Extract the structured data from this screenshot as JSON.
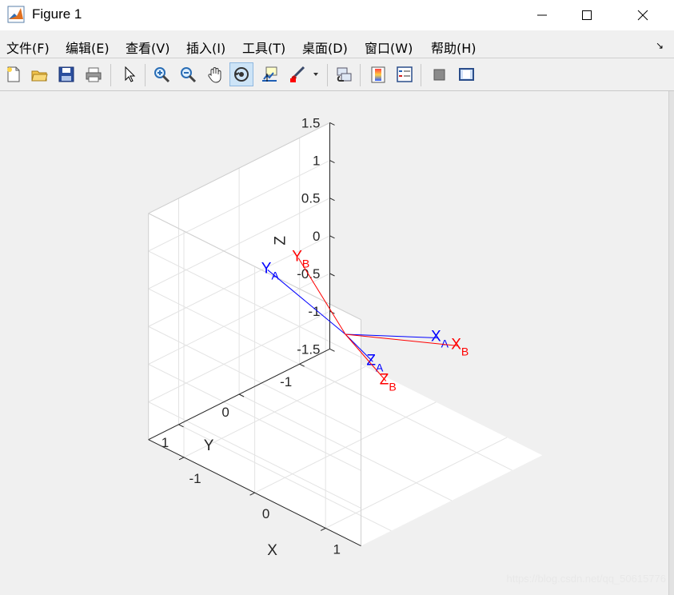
{
  "window": {
    "title": "Figure 1",
    "controls": {
      "minimize": "—",
      "maximize": "☐",
      "close": "✕"
    }
  },
  "menu": {
    "items": [
      "文件(F)",
      "编辑(E)",
      "查看(V)",
      "插入(I)",
      "工具(T)",
      "桌面(D)",
      "窗口(W)",
      "帮助(H)"
    ],
    "dock_arrow": "↘"
  },
  "toolbar": {
    "buttons": [
      {
        "name": "new-figure-icon"
      },
      {
        "name": "open-file-icon"
      },
      {
        "name": "save-icon"
      },
      {
        "name": "print-icon"
      },
      {
        "name": "edit-plot-pointer-icon"
      },
      {
        "name": "zoom-in-icon"
      },
      {
        "name": "zoom-out-icon"
      },
      {
        "name": "pan-hand-icon"
      },
      {
        "name": "rotate-3d-icon",
        "active": true
      },
      {
        "name": "data-cursor-icon"
      },
      {
        "name": "brush-icon"
      },
      {
        "name": "link-plot-icon"
      },
      {
        "name": "insert-colorbar-icon"
      },
      {
        "name": "insert-legend-icon"
      },
      {
        "name": "hide-plot-tools-icon"
      },
      {
        "name": "show-plot-tools-icon"
      }
    ]
  },
  "chart_data": {
    "type": "3d-line",
    "zlabel": "Z",
    "xlabel": "X",
    "ylabel": "Y",
    "xlim": [
      -1.5,
      1.5
    ],
    "ylim": [
      -1.5,
      1.5
    ],
    "zlim": [
      -1.5,
      1.5
    ],
    "grid": true,
    "z_ticks": [
      "1.5",
      "1",
      "0.5",
      "0",
      "-0.5",
      "-1",
      "-1.5"
    ],
    "y_ticks": [
      "1",
      "0",
      "-1"
    ],
    "x_ticks": [
      "-1",
      "0",
      "1"
    ],
    "frames": [
      {
        "name": "A",
        "color": "#0000ff",
        "axes": [
          {
            "label": "X",
            "subscript": "A",
            "vector": [
              0.7,
              -0.7,
              0.0
            ]
          },
          {
            "label": "Y",
            "subscript": "A",
            "vector": [
              -0.5,
              0.7,
              0.9
            ]
          },
          {
            "label": "Z",
            "subscript": "A",
            "vector": [
              0.9,
              0.6,
              0.3
            ]
          }
        ]
      },
      {
        "name": "B",
        "color": "#ff0000",
        "axes": [
          {
            "label": "X",
            "subscript": "B",
            "vector": [
              0.9,
              -0.8,
              -0.05
            ]
          },
          {
            "label": "Y",
            "subscript": "B",
            "vector": [
              -0.45,
              0.25,
              0.9
            ]
          },
          {
            "label": "Z",
            "subscript": "B",
            "vector": [
              1.0,
              0.5,
              0.05
            ]
          }
        ]
      }
    ]
  },
  "watermark": "https://blog.csdn.net/qq_50615776"
}
